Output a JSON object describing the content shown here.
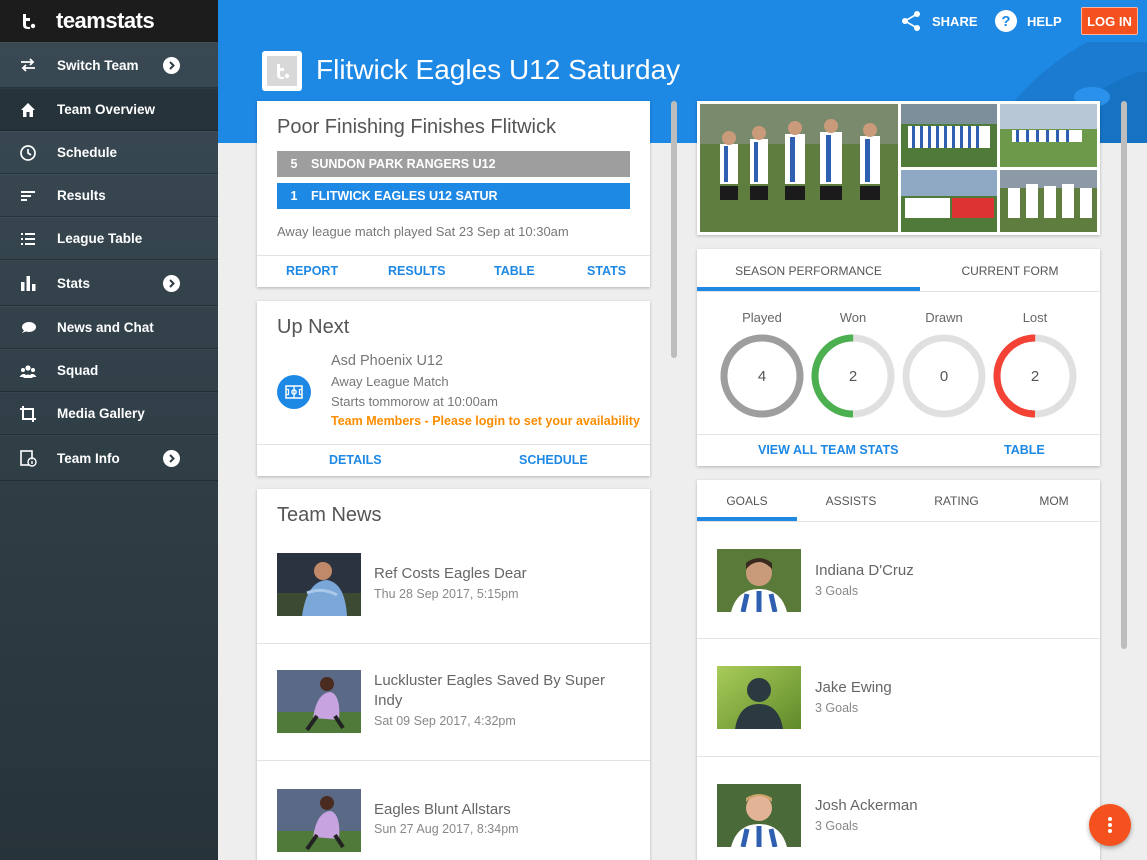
{
  "brand": {
    "name": "teamstats"
  },
  "sidebar": {
    "items": [
      {
        "label": "Switch Team",
        "icon": "swap-icon",
        "has_arrow": true
      },
      {
        "label": "Team Overview",
        "icon": "home-icon",
        "has_arrow": false
      },
      {
        "label": "Schedule",
        "icon": "clock-icon",
        "has_arrow": false
      },
      {
        "label": "Results",
        "icon": "results-icon",
        "has_arrow": false
      },
      {
        "label": "League Table",
        "icon": "list-icon",
        "has_arrow": false
      },
      {
        "label": "Stats",
        "icon": "bar-chart-icon",
        "has_arrow": true
      },
      {
        "label": "News and Chat",
        "icon": "chat-icon",
        "has_arrow": false
      },
      {
        "label": "Squad",
        "icon": "group-icon",
        "has_arrow": false
      },
      {
        "label": "Media Gallery",
        "icon": "crop-icon",
        "has_arrow": false
      },
      {
        "label": "Team Info",
        "icon": "info-icon",
        "has_arrow": true
      }
    ]
  },
  "topbar": {
    "share": "SHARE",
    "help": "HELP",
    "login": "LOG IN"
  },
  "team": {
    "name": "Flitwick Eagles U12 Saturday"
  },
  "last_result": {
    "title": "Poor Finishing Finishes Flitwick",
    "home": {
      "score": "5",
      "name": "SUNDON PARK RANGERS U12"
    },
    "away": {
      "score": "1",
      "name": "FLITWICK EAGLES U12 SATUR"
    },
    "info": "Away league match played Sat 23 Sep at 10:30am",
    "links": [
      "REPORT",
      "RESULTS",
      "TABLE",
      "STATS"
    ]
  },
  "up_next": {
    "title": "Up Next",
    "opponent": "Asd Phoenix U12",
    "match_type": "Away League Match",
    "start": "Starts tommorow at 10:00am",
    "availability": "Team Members - Please login to set your availability",
    "links": [
      "DETAILS",
      "SCHEDULE"
    ]
  },
  "news": {
    "title": "Team News",
    "items": [
      {
        "title": "Ref Costs Eagles Dear",
        "date": "Thu 28 Sep 2017, 5:15pm"
      },
      {
        "title": "Luckluster Eagles Saved By Super Indy",
        "date": "Sat 09 Sep 2017, 4:32pm"
      },
      {
        "title": "Eagles Blunt Allstars",
        "date": "Sun 27 Aug 2017, 8:34pm"
      }
    ]
  },
  "season": {
    "tabs": [
      "SEASON PERFORMANCE",
      "CURRENT FORM"
    ],
    "stats": [
      {
        "label": "Played",
        "value": "4",
        "color": "#9e9e9e",
        "fill": 1.0
      },
      {
        "label": "Won",
        "value": "2",
        "color": "#4caf50",
        "fill": 0.5
      },
      {
        "label": "Drawn",
        "value": "0",
        "color": "#e0e0e0",
        "fill": 0.0
      },
      {
        "label": "Lost",
        "value": "2",
        "color": "#f44336",
        "fill": 0.5
      }
    ],
    "links": [
      "VIEW ALL TEAM STATS",
      "TABLE"
    ]
  },
  "leaders": {
    "tabs": [
      "GOALS",
      "ASSISTS",
      "RATING",
      "MOM"
    ],
    "players": [
      {
        "name": "Indiana D'Cruz",
        "stat": "3 Goals"
      },
      {
        "name": "Jake Ewing",
        "stat": "3 Goals"
      },
      {
        "name": "Josh Ackerman",
        "stat": "3 Goals"
      }
    ]
  },
  "colors": {
    "primary": "#1e88e5",
    "accent": "#f4511e",
    "sidebar": "#2f3d45",
    "warning": "#fb8c00"
  }
}
